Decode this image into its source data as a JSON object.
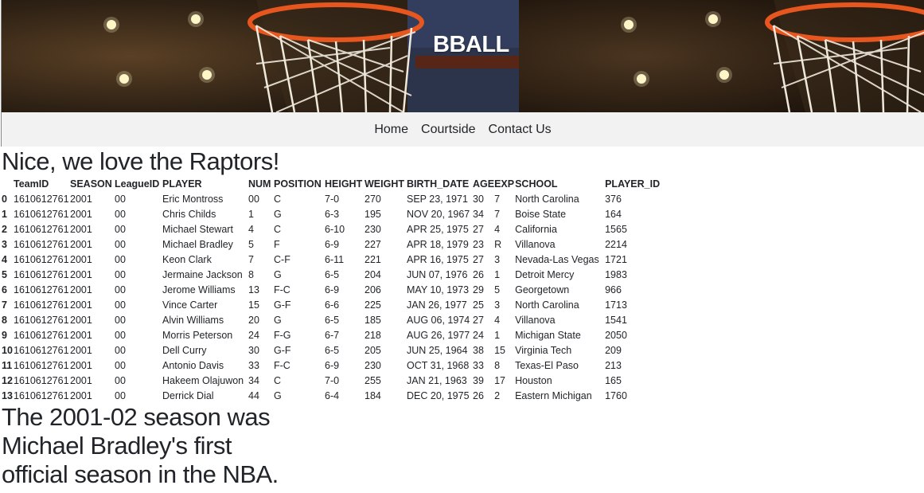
{
  "banner": {
    "title": "BBALL"
  },
  "nav": {
    "items": [
      "Home",
      "Courtside",
      "Contact Us"
    ]
  },
  "heading": "Nice, we love the Raptors!",
  "table": {
    "headers": [
      "",
      "TeamID",
      "SEASON",
      "LeagueID",
      "PLAYER",
      "NUM",
      "POSITION",
      "HEIGHT",
      "WEIGHT",
      "BIRTH_DATE",
      "AGE",
      "EXP",
      "SCHOOL",
      "PLAYER_ID"
    ],
    "rows": [
      [
        "0",
        "1610612761",
        "2001",
        "00",
        "Eric Montross",
        "00",
        "C",
        "7-0",
        "270",
        "SEP 23, 1971",
        "30",
        "7",
        "North Carolina",
        "376"
      ],
      [
        "1",
        "1610612761",
        "2001",
        "00",
        "Chris Childs",
        "1",
        "G",
        "6-3",
        "195",
        "NOV 20, 1967",
        "34",
        "7",
        "Boise State",
        "164"
      ],
      [
        "2",
        "1610612761",
        "2001",
        "00",
        "Michael Stewart",
        "4",
        "C",
        "6-10",
        "230",
        "APR 25, 1975",
        "27",
        "4",
        "California",
        "1565"
      ],
      [
        "3",
        "1610612761",
        "2001",
        "00",
        "Michael Bradley",
        "5",
        "F",
        "6-9",
        "227",
        "APR 18, 1979",
        "23",
        "R",
        "Villanova",
        "2214"
      ],
      [
        "4",
        "1610612761",
        "2001",
        "00",
        "Keon Clark",
        "7",
        "C-F",
        "6-11",
        "221",
        "APR 16, 1975",
        "27",
        "3",
        "Nevada-Las Vegas",
        "1721"
      ],
      [
        "5",
        "1610612761",
        "2001",
        "00",
        "Jermaine Jackson",
        "8",
        "G",
        "6-5",
        "204",
        "JUN 07, 1976",
        "26",
        "1",
        "Detroit Mercy",
        "1983"
      ],
      [
        "6",
        "1610612761",
        "2001",
        "00",
        "Jerome Williams",
        "13",
        "F-C",
        "6-9",
        "206",
        "MAY 10, 1973",
        "29",
        "5",
        "Georgetown",
        "966"
      ],
      [
        "7",
        "1610612761",
        "2001",
        "00",
        "Vince Carter",
        "15",
        "G-F",
        "6-6",
        "225",
        "JAN 26, 1977",
        "25",
        "3",
        "North Carolina",
        "1713"
      ],
      [
        "8",
        "1610612761",
        "2001",
        "00",
        "Alvin Williams",
        "20",
        "G",
        "6-5",
        "185",
        "AUG 06, 1974",
        "27",
        "4",
        "Villanova",
        "1541"
      ],
      [
        "9",
        "1610612761",
        "2001",
        "00",
        "Morris Peterson",
        "24",
        "F-G",
        "6-7",
        "218",
        "AUG 26, 1977",
        "24",
        "1",
        "Michigan State",
        "2050"
      ],
      [
        "10",
        "1610612761",
        "2001",
        "00",
        "Dell Curry",
        "30",
        "G-F",
        "6-5",
        "205",
        "JUN 25, 1964",
        "38",
        "15",
        "Virginia Tech",
        "209"
      ],
      [
        "11",
        "1610612761",
        "2001",
        "00",
        "Antonio Davis",
        "33",
        "F-C",
        "6-9",
        "230",
        "OCT 31, 1968",
        "33",
        "8",
        "Texas-El Paso",
        "213"
      ],
      [
        "12",
        "1610612761",
        "2001",
        "00",
        "Hakeem Olajuwon",
        "34",
        "C",
        "7-0",
        "255",
        "JAN 21, 1963",
        "39",
        "17",
        "Houston",
        "165"
      ],
      [
        "13",
        "1610612761",
        "2001",
        "00",
        "Derrick Dial",
        "44",
        "G",
        "6-4",
        "184",
        "DEC 20, 1975",
        "26",
        "2",
        "Eastern Michigan",
        "1760"
      ]
    ]
  },
  "fact": "The 2001-02 season was Michael Bradley's first official season in the NBA."
}
